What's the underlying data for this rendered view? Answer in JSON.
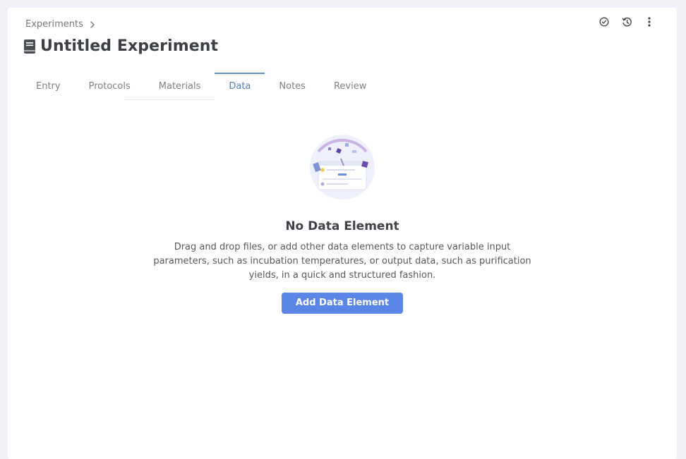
{
  "breadcrumb": {
    "label": "Experiments"
  },
  "page": {
    "title": "Untitled Experiment"
  },
  "tabs": [
    {
      "label": "Entry"
    },
    {
      "label": "Protocols"
    },
    {
      "label": "Materials"
    },
    {
      "label": "Data"
    },
    {
      "label": "Notes"
    },
    {
      "label": "Review"
    }
  ],
  "active_tab": "Data",
  "empty_state": {
    "heading": "No Data Element",
    "description": "Drag and drop files, or add other data elements to capture variable input parameters, such as incubation temperatures, or output data, such as purification yields, in a quick and structured fashion.",
    "button_label": "Add Data Element"
  },
  "icons": {
    "breadcrumb": "chevron-right-icon",
    "title": "notebook-icon",
    "actions": [
      "check-circle-icon",
      "history-icon",
      "more-vertical-icon"
    ]
  },
  "colors": {
    "accent": "#5b86e8",
    "active_tab": "#5b7fb8",
    "background": "#f0f2f8"
  }
}
